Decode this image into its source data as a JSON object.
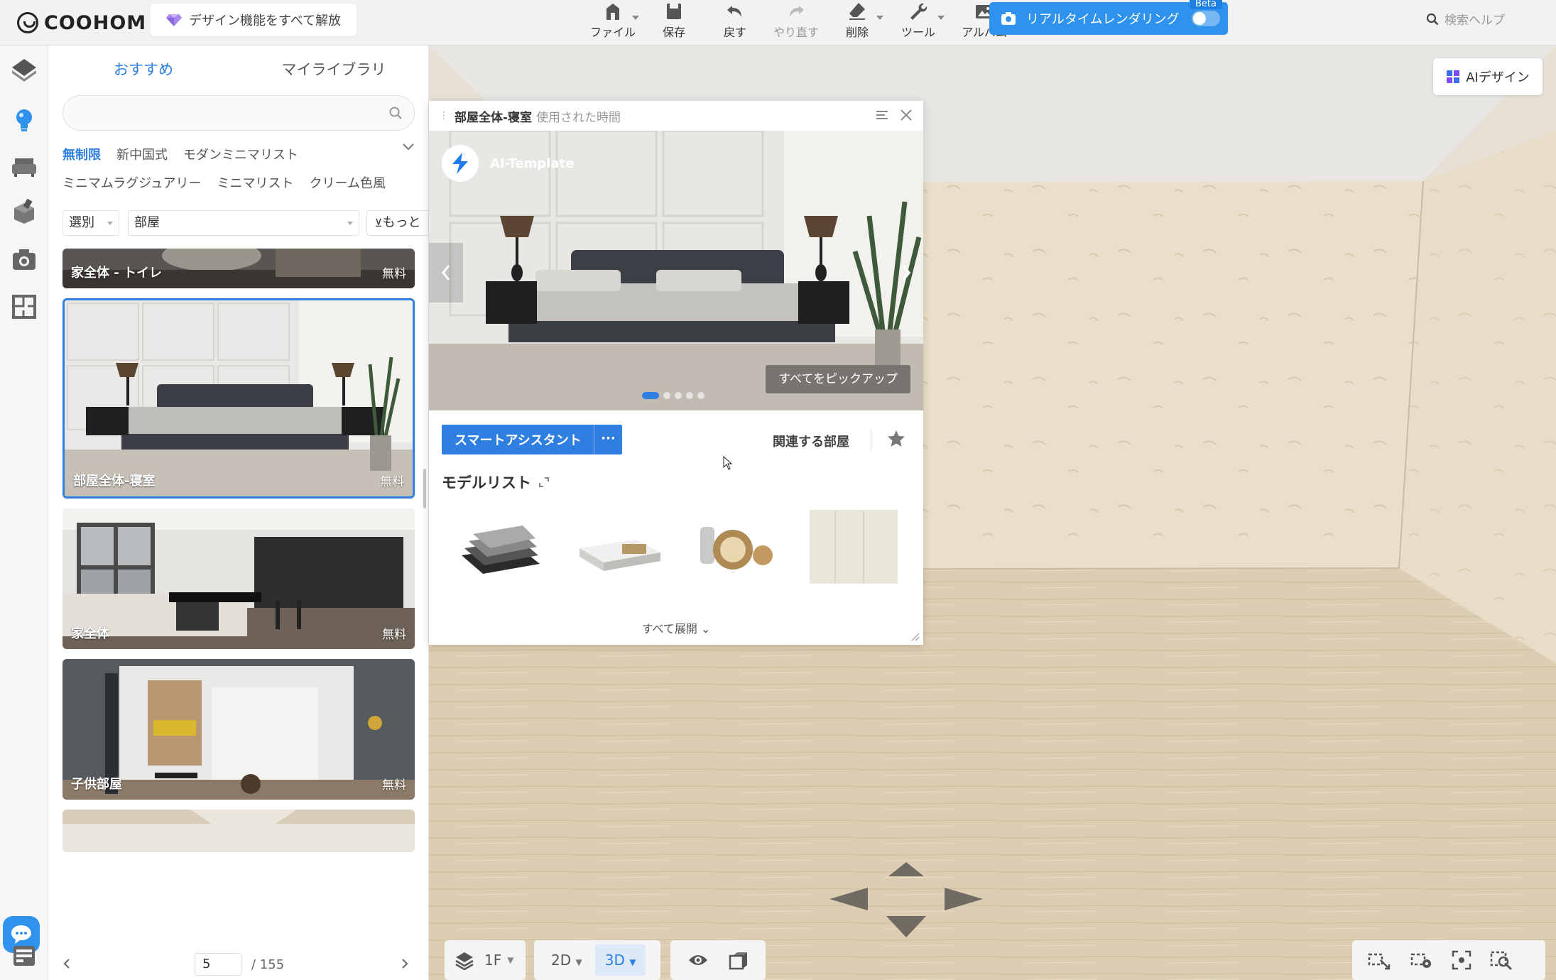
{
  "header": {
    "logo_text": "COOHOM",
    "unlock_label": "デザイン機能をすべて解放",
    "tools": [
      {
        "label": "ファイル",
        "icon": "file-icon"
      },
      {
        "label": "保存",
        "icon": "save-icon"
      },
      {
        "label": "戻す",
        "icon": "undo-icon"
      },
      {
        "label": "やり直す",
        "icon": "redo-icon"
      },
      {
        "label": "削除",
        "icon": "eraser-icon"
      },
      {
        "label": "ツール",
        "icon": "wrench-icon"
      },
      {
        "label": "アルバム",
        "icon": "album-icon"
      }
    ],
    "render_label": "リアルタイムレンダリング",
    "beta_label": "Beta",
    "help_placeholder": "検索ヘルプ"
  },
  "left_panel": {
    "tabs": [
      "おすすめ",
      "マイライブラリ"
    ],
    "styles_row1": [
      "無制限",
      "新中国式",
      "モダンミニマリスト"
    ],
    "styles_row2": [
      "ミニマムラグジュアリー",
      "ミニマリスト",
      "クリーム色風"
    ],
    "select_label": "選別",
    "room_select": "部屋",
    "more_label": "もっと",
    "cards": [
      {
        "label": "家全体 - トイレ",
        "price": "無料"
      },
      {
        "label": "部屋全体-寝室",
        "price": "無料"
      },
      {
        "label": "家全体",
        "price": "無料"
      },
      {
        "label": "子供部屋",
        "price": "無料"
      }
    ],
    "pager": {
      "current": "5",
      "total": "/ 155"
    }
  },
  "popup": {
    "title": "部屋全体-寝室",
    "subtitle": "使用された時間",
    "ai_template": "AI-Template",
    "pickup_label": "すべてをピックアップ",
    "slides": 5,
    "active_slide": 1,
    "smart_assistant": "スマートアシスタント",
    "smart_more": "···",
    "related_rooms": "関連する部屋",
    "model_list_title": "モデルリスト",
    "expand_all": "すべて展開"
  },
  "viewport": {
    "ai_design_label": "AIデザイン",
    "floor": "1F",
    "view_2d": "2D",
    "view_3d": "3D"
  },
  "colors": {
    "accent": "#2f7fe0",
    "render_blue": "#2f93ee"
  }
}
